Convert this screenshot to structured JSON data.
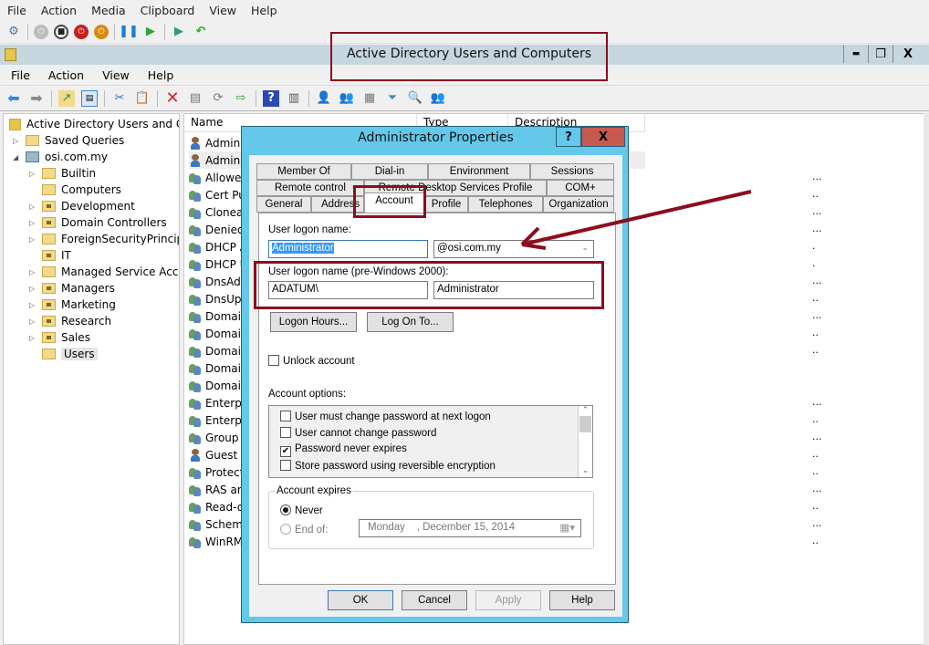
{
  "vm_window": {
    "menu": [
      "File",
      "Action",
      "Media",
      "Clipboard",
      "View",
      "Help"
    ],
    "toolbar_icons": [
      "ctrl-alt-del-icon",
      "start-icon",
      "turn-off-icon",
      "shutdown-icon",
      "power-icon",
      "pause-icon",
      "resume-icon",
      "checkpoint-icon",
      "revert-icon"
    ]
  },
  "mmc": {
    "title": "Active Directory Users and Computers",
    "menu": [
      "File",
      "Action",
      "View",
      "Help"
    ],
    "toolbar_icons": [
      "back-icon",
      "forward-icon",
      "up-icon",
      "show-hide-tree-icon",
      "cut-icon",
      "paste-icon",
      "delete-icon",
      "properties-icon",
      "refresh-icon",
      "export-icon",
      "help-icon",
      "action-pane-icon",
      "new-user-icon",
      "new-group-icon",
      "new-ou-icon",
      "filter-icon",
      "find-icon",
      "add-to-group-icon"
    ],
    "window_buttons": {
      "minimize": "▬",
      "restore": "❐",
      "close": "X"
    }
  },
  "tree": {
    "root": "Active Directory Users and Com",
    "items": [
      {
        "label": "Saved Queries",
        "expandable": true,
        "level": 1,
        "ou": false
      },
      {
        "label": "osi.com.my",
        "expandable": true,
        "expanded": true,
        "level": 1,
        "domain": true
      },
      {
        "label": "Builtin",
        "expandable": true,
        "level": 2,
        "ou": false
      },
      {
        "label": "Computers",
        "expandable": false,
        "level": 2,
        "ou": false
      },
      {
        "label": "Development",
        "expandable": true,
        "level": 2,
        "ou": true
      },
      {
        "label": "Domain Controllers",
        "expandable": true,
        "level": 2,
        "ou": true
      },
      {
        "label": "ForeignSecurityPrincipals",
        "expandable": true,
        "level": 2,
        "ou": false
      },
      {
        "label": "IT",
        "expandable": false,
        "level": 2,
        "ou": true
      },
      {
        "label": "Managed Service Accour",
        "expandable": true,
        "level": 2,
        "ou": false
      },
      {
        "label": "Managers",
        "expandable": true,
        "level": 2,
        "ou": true
      },
      {
        "label": "Marketing",
        "expandable": true,
        "level": 2,
        "ou": true
      },
      {
        "label": "Research",
        "expandable": true,
        "level": 2,
        "ou": true
      },
      {
        "label": "Sales",
        "expandable": true,
        "level": 2,
        "ou": true
      },
      {
        "label": "Users",
        "expandable": false,
        "level": 2,
        "ou": false,
        "selected": true
      }
    ]
  },
  "list": {
    "columns": [
      "Name",
      "Type",
      "Description"
    ],
    "rows": [
      {
        "name": "Admin",
        "kind": "user"
      },
      {
        "name": "Admini",
        "kind": "user",
        "selected": true
      },
      {
        "name": "Allowed",
        "kind": "group"
      },
      {
        "name": "Cert Pu",
        "kind": "group"
      },
      {
        "name": "Cloneal",
        "kind": "group"
      },
      {
        "name": "Denied",
        "kind": "group"
      },
      {
        "name": "DHCP A",
        "kind": "group"
      },
      {
        "name": "DHCP U",
        "kind": "group"
      },
      {
        "name": "DnsAdm",
        "kind": "group"
      },
      {
        "name": "DnsUpd",
        "kind": "group"
      },
      {
        "name": "Domain",
        "kind": "group"
      },
      {
        "name": "Domain",
        "kind": "group"
      },
      {
        "name": "Domain",
        "kind": "group"
      },
      {
        "name": "Domain",
        "kind": "group"
      },
      {
        "name": "Domain",
        "kind": "group"
      },
      {
        "name": "Enterpr",
        "kind": "group"
      },
      {
        "name": "Enterpr",
        "kind": "group"
      },
      {
        "name": "Group P",
        "kind": "group"
      },
      {
        "name": "Guest",
        "kind": "user"
      },
      {
        "name": "Protect",
        "kind": "group"
      },
      {
        "name": "RAS and",
        "kind": "group"
      },
      {
        "name": "Read-o",
        "kind": "group"
      },
      {
        "name": "Schema",
        "kind": "group"
      },
      {
        "name": "WinRM",
        "kind": "group"
      }
    ],
    "truncated_desc": [
      "",
      "",
      "...",
      "..",
      "...",
      "...",
      ".",
      ".",
      "...",
      "..",
      "...",
      "..",
      "..",
      "",
      "",
      "...",
      "..",
      "...",
      "..",
      "..",
      "...",
      "..",
      "...",
      ".."
    ]
  },
  "dialog": {
    "title": "Administrator Properties",
    "help": "?",
    "close": "X",
    "tabs_row1": [
      "Member Of",
      "Dial-in",
      "Environment",
      "Sessions"
    ],
    "tabs_row2": [
      "Remote control",
      "Remote Desktop Services Profile",
      "COM+"
    ],
    "tabs_row3": [
      "General",
      "Address",
      "Account",
      "Profile",
      "Telephones",
      "Organization"
    ],
    "active_tab": "Account",
    "logon_label": "User logon name:",
    "logon_value": "Administrator",
    "suffix_value": "@osi.com.my",
    "pre2000_label": "User logon name (pre-Windows 2000):",
    "pre2000_domain": "ADATUM\\",
    "pre2000_user": "Administrator",
    "logon_hours_btn": "Logon Hours...",
    "log_on_to_btn": "Log On To...",
    "unlock_label": "Unlock account",
    "unlock_checked": false,
    "options_label": "Account options:",
    "options": [
      {
        "label": "User must change password at next logon",
        "checked": false
      },
      {
        "label": "User cannot change password",
        "checked": false
      },
      {
        "label": "Password never expires",
        "checked": true
      },
      {
        "label": "Store password using reversible encryption",
        "checked": false
      }
    ],
    "expires_label": "Account expires",
    "never_label": "Never",
    "never_selected": true,
    "endof_label": "End of:",
    "endof_date": "Monday    , December 15, 2014",
    "buttons": {
      "ok": "OK",
      "cancel": "Cancel",
      "apply": "Apply",
      "help": "Help"
    }
  },
  "annotation_color": "#8b0d1e",
  "dialog_frame_color": "#63c8ea"
}
